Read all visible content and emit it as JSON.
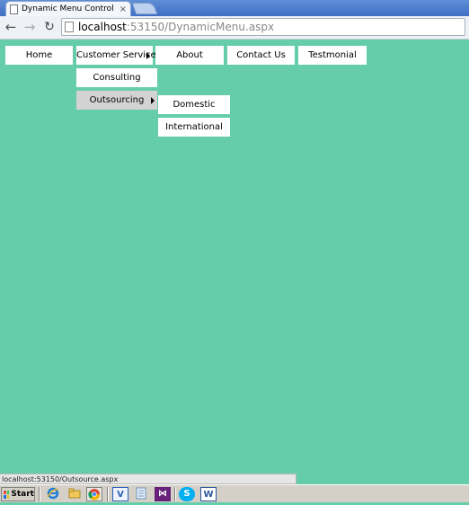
{
  "browser": {
    "tab_title": "Dynamic Menu Control Article",
    "tab_close": "×",
    "url_host": "localhost",
    "url_rest": ":53150/DynamicMenu.aspx",
    "back_icon": "←",
    "forward_icon": "→",
    "reload_icon": "↻"
  },
  "menu": {
    "top": [
      "Home",
      "Customer Service",
      "About",
      "Contact Us",
      "Testmonial"
    ],
    "customer_service_sub": [
      "Consulting",
      "Outsourcing"
    ],
    "outsourcing_sub": [
      "Domestic",
      "International"
    ],
    "active_submenu_item": "Outsourcing",
    "colors": {
      "page_bg": "#66cdaa",
      "item_bg": "#ffffff",
      "active_bg": "#d3d3d3"
    }
  },
  "status_bar": {
    "text": "localhost:53150/Outsource.aspx"
  },
  "taskbar": {
    "start_label": "Start",
    "icons": [
      "ie-icon",
      "explorer-icon",
      "chrome-icon",
      "visio-icon",
      "notepad-icon",
      "visual-studio-icon",
      "skype-icon",
      "word-icon"
    ],
    "visio_glyph": "V",
    "vs_glyph": "⋈",
    "skype_glyph": "S",
    "word_glyph": "W"
  }
}
